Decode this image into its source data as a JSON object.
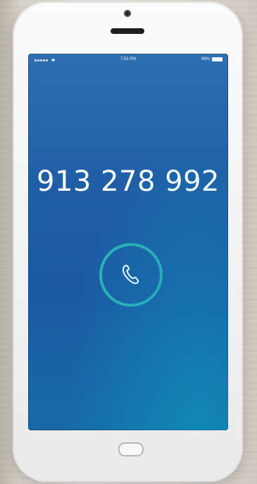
{
  "status_bar": {
    "time": "7:53 PM",
    "battery_text": "98%",
    "signal_icon": "signal-dots-icon",
    "wifi_icon": "wifi-icon",
    "battery_icon": "battery-icon"
  },
  "call_screen": {
    "phone_number": "913 278 992",
    "call_icon": "phone-handset-icon",
    "call_ring_color": "#2fb1b6"
  },
  "device": {
    "camera_icon": "front-camera-icon",
    "speaker_icon": "earpiece-speaker-icon",
    "home_button_icon": "home-button-icon"
  },
  "colors": {
    "screen_gradient_top": "#2d6fb0",
    "screen_gradient_bottom": "#176aa6",
    "accent_teal": "#2fb1b6"
  }
}
